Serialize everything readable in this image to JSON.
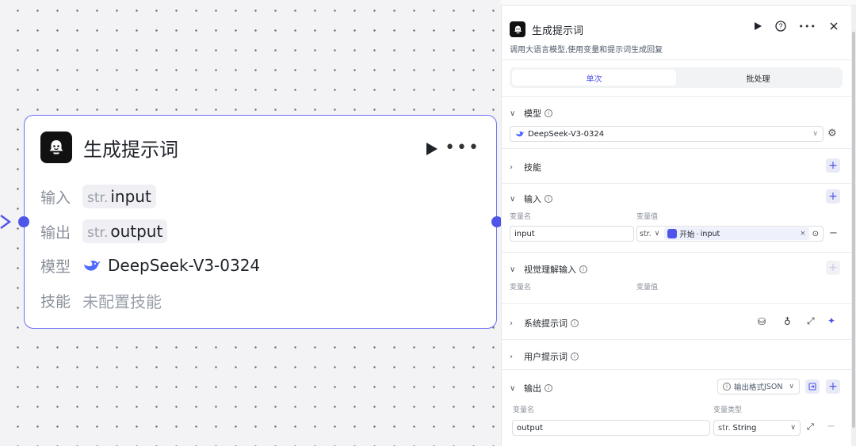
{
  "node": {
    "title": "生成提示词",
    "input_label": "输入",
    "input_type": "str.",
    "input_value": "input",
    "output_label": "输出",
    "output_type": "str.",
    "output_value": "output",
    "model_label": "模型",
    "model_value": "DeepSeek-V3-0324",
    "skill_label": "技能",
    "skill_value": "未配置技能"
  },
  "panel": {
    "title": "生成提示词",
    "description": "调用大语言模型,使用变量和提示词生成回复",
    "tabs": [
      {
        "label": "单次",
        "active": true
      },
      {
        "label": "批处理",
        "active": false
      }
    ],
    "model": {
      "label": "模型",
      "value": "DeepSeek-V3-0324"
    },
    "skills": {
      "label": "技能"
    },
    "input": {
      "label": "输入",
      "col_name": "变量名",
      "col_value": "变量值",
      "row": {
        "name": "input",
        "type": "str.",
        "ref_source": "开始",
        "ref_sep": "-",
        "ref_var": "input"
      }
    },
    "vision": {
      "label": "视觉理解输入",
      "col_name": "变量名",
      "col_value": "变量值"
    },
    "system_prompt": {
      "label": "系统提示词"
    },
    "user_prompt": {
      "label": "用户提示词"
    },
    "output": {
      "label": "输出",
      "format_label": "输出格式",
      "format_value": "JSON",
      "col_name": "变量名",
      "col_type": "变量类型",
      "row": {
        "name": "output",
        "type_prefix": "str.",
        "type": "String"
      }
    }
  },
  "colors": {
    "accent": "#4f55e8",
    "node_border": "#6c6ff0"
  }
}
